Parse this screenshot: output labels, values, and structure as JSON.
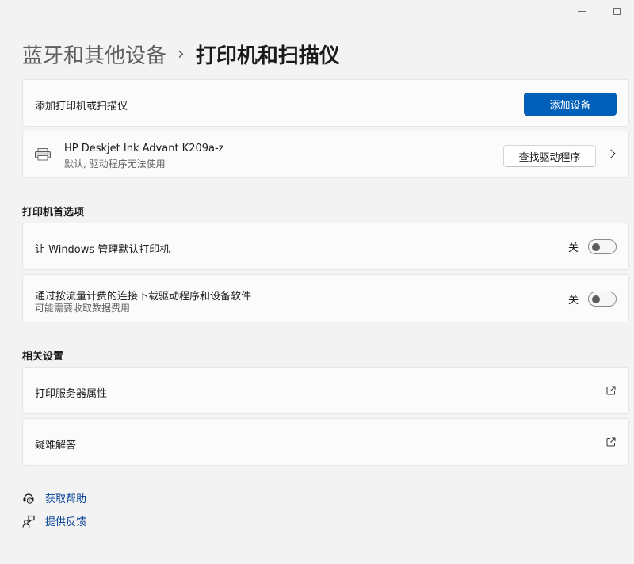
{
  "window": {
    "minimize_icon": "minimize-icon",
    "maximize_icon": "maximize-icon"
  },
  "breadcrumb": {
    "parent": "蓝牙和其他设备",
    "separator": "›",
    "current": "打印机和扫描仪"
  },
  "add_device": {
    "label": "添加打印机或扫描仪",
    "button": "添加设备"
  },
  "printer": {
    "name": "HP Deskjet Ink Advant K209a-z",
    "status": "默认, 驱动程序无法使用",
    "button": "查找驱动程序",
    "icon": "printer-icon"
  },
  "preferences": {
    "title": "打印机首选项",
    "items": [
      {
        "label": "让 Windows 管理默认打印机",
        "sub": "",
        "state": "关",
        "on": false
      },
      {
        "label": "通过按流量计费的连接下载驱动程序和设备软件",
        "sub": "可能需要收取数据费用",
        "state": "关",
        "on": false
      }
    ]
  },
  "related": {
    "title": "相关设置",
    "items": [
      {
        "label": "打印服务器属性",
        "icon": "open-external-icon"
      },
      {
        "label": "疑难解答",
        "icon": "open-external-icon"
      }
    ]
  },
  "help": {
    "get_help": "获取帮助",
    "feedback": "提供反馈"
  },
  "colors": {
    "accent": "#005fb8",
    "link": "#003e92",
    "background": "#f3f3f3",
    "card": "#fbfbfb"
  }
}
